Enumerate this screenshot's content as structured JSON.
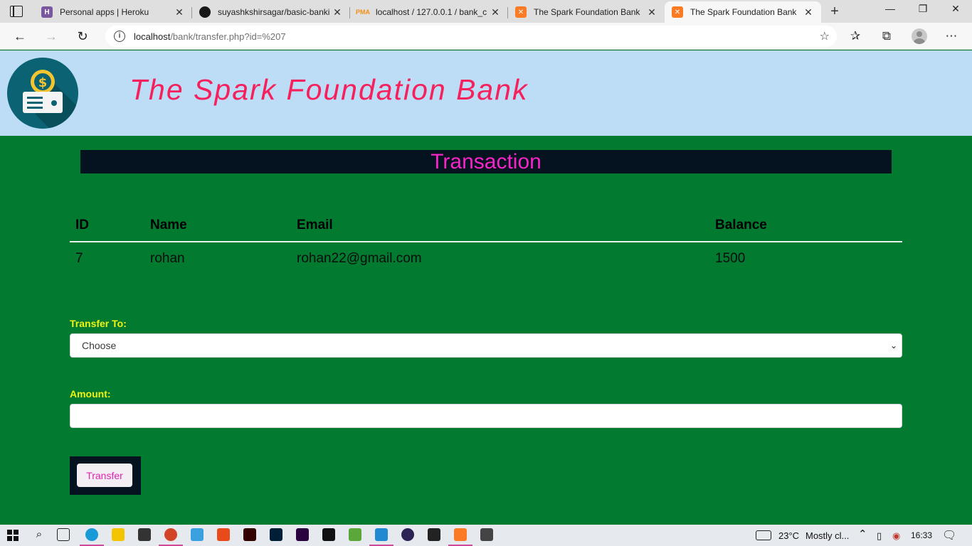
{
  "browser": {
    "tabs": [
      {
        "title": "Personal apps | Heroku",
        "favicon": "heroku-icon",
        "color": "#79589f",
        "active": false
      },
      {
        "title": "suyashkshirsagar/basic-banki",
        "favicon": "github-icon",
        "color": "#181717",
        "active": false
      },
      {
        "title": "localhost / 127.0.0.1 / bank_c",
        "favicon": "phpmyadmin-icon",
        "color": "#f29111",
        "active": false
      },
      {
        "title": "The Spark Foundation Bank",
        "favicon": "xampp-icon",
        "color": "#fb7a24",
        "active": false
      },
      {
        "title": "The Spark Foundation Bank",
        "favicon": "xampp-icon",
        "color": "#fb7a24",
        "active": true
      }
    ],
    "url_host": "localhost",
    "url_path": "/bank/transfer.php?id=%207"
  },
  "header": {
    "bank_name": "The Spark Foundation Bank",
    "logo_icon": "bank-card-dollar-icon"
  },
  "section_title": "Transaction",
  "account_table": {
    "headers": [
      "ID",
      "Name",
      "Email",
      "Balance"
    ],
    "row": [
      "7",
      "rohan",
      "rohan22@gmail.com",
      "1500"
    ]
  },
  "form": {
    "transfer_to_label": "Transfer To:",
    "transfer_to_value": "Choose",
    "amount_label": "Amount:",
    "amount_value": "",
    "submit_label": "Transfer"
  },
  "taskbar": {
    "weather_temp": "23°C",
    "weather_text": "Mostly cl...",
    "time": "16:33"
  },
  "colors": {
    "page_bg": "#027a30",
    "header_bg": "#bddcf6",
    "title": "#f5205c",
    "section_title": "#f724c8",
    "label": "#f1f313"
  }
}
